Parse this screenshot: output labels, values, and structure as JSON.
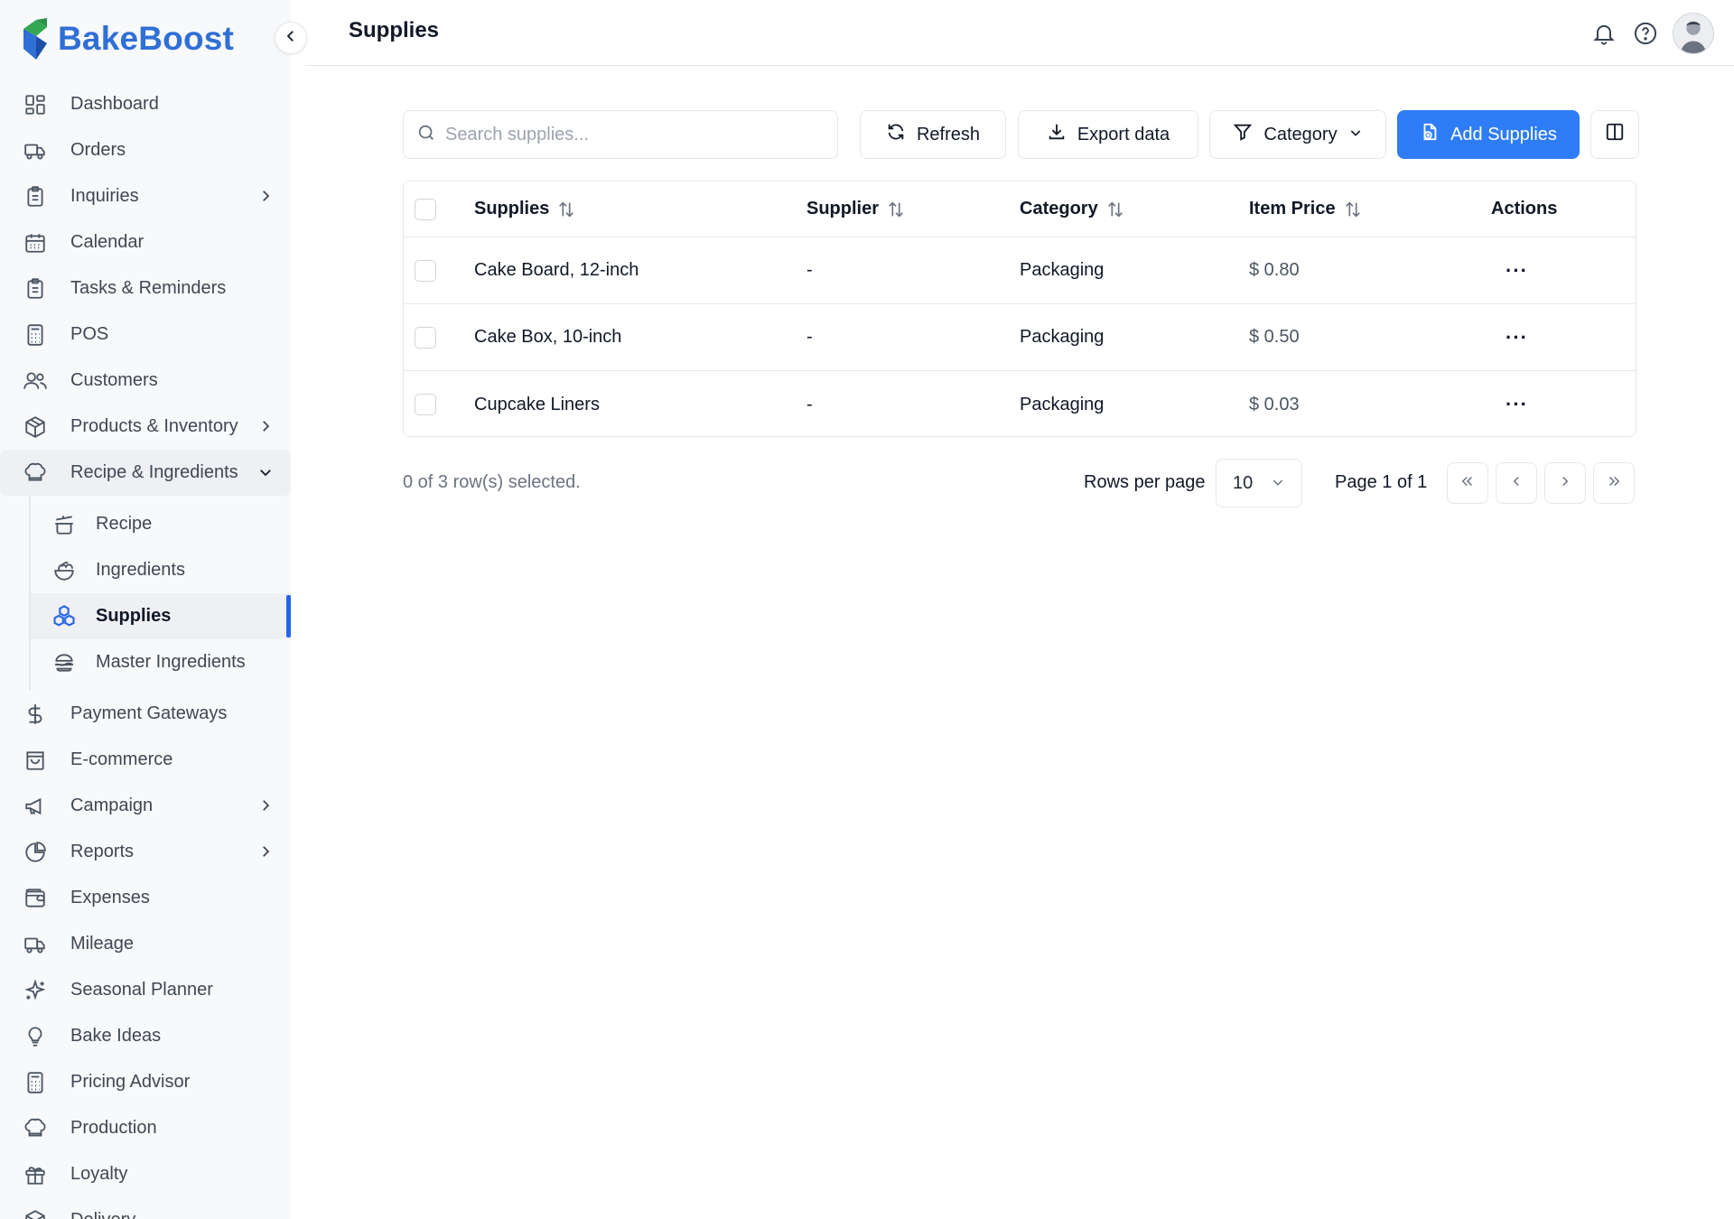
{
  "brand": {
    "name": "BakeBoost"
  },
  "colors": {
    "accent": "#2f7df6",
    "active_indicator": "#2563eb",
    "brand_text": "#2f6fd6"
  },
  "sidebar": {
    "items": [
      {
        "label": "Dashboard",
        "icon": "grid-icon"
      },
      {
        "label": "Orders",
        "icon": "truck-icon"
      },
      {
        "label": "Inquiries",
        "icon": "clipboard-icon",
        "has_submenu": true
      },
      {
        "label": "Calendar",
        "icon": "calendar-icon"
      },
      {
        "label": "Tasks & Reminders",
        "icon": "clipboard-list-icon"
      },
      {
        "label": "POS",
        "icon": "calculator-icon"
      },
      {
        "label": "Customers",
        "icon": "users-icon"
      },
      {
        "label": "Products & Inventory",
        "icon": "package-icon",
        "has_submenu": true
      },
      {
        "label": "Recipe & Ingredients",
        "icon": "chef-hat-icon",
        "expanded": true
      }
    ],
    "subitems": [
      {
        "label": "Recipe",
        "icon": "cooking-pot-icon"
      },
      {
        "label": "Ingredients",
        "icon": "salad-icon"
      },
      {
        "label": "Supplies",
        "icon": "boxes-icon",
        "active": true
      },
      {
        "label": "Master Ingredients",
        "icon": "sandwich-icon"
      }
    ],
    "items_after": [
      {
        "label": "Payment Gateways",
        "icon": "dollar-icon"
      },
      {
        "label": "E-commerce",
        "icon": "shopping-bag-icon"
      },
      {
        "label": "Campaign",
        "icon": "megaphone-icon",
        "has_submenu": true
      },
      {
        "label": "Reports",
        "icon": "pie-chart-icon",
        "has_submenu": true
      },
      {
        "label": "Expenses",
        "icon": "wallet-icon"
      },
      {
        "label": "Mileage",
        "icon": "truck-icon"
      },
      {
        "label": "Seasonal Planner",
        "icon": "sparkles-icon"
      },
      {
        "label": "Bake Ideas",
        "icon": "lightbulb-icon"
      },
      {
        "label": "Pricing Advisor",
        "icon": "calculator-icon"
      },
      {
        "label": "Production",
        "icon": "chef-hat-icon"
      },
      {
        "label": "Loyalty",
        "icon": "gift-icon"
      },
      {
        "label": "Delivery",
        "icon": "package-icon"
      }
    ]
  },
  "header": {
    "title": "Supplies"
  },
  "toolbar": {
    "search_placeholder": "Search supplies...",
    "refresh_label": "Refresh",
    "export_label": "Export data",
    "category_label": "Category",
    "add_label": "Add Supplies"
  },
  "table": {
    "columns": [
      "Supplies",
      "Supplier",
      "Category",
      "Item Price",
      "Actions"
    ],
    "rows": [
      {
        "name": "Cake Board, 12-inch",
        "supplier": "-",
        "category": "Packaging",
        "price": "$ 0.80"
      },
      {
        "name": "Cake Box, 10-inch",
        "supplier": "-",
        "category": "Packaging",
        "price": "$ 0.50"
      },
      {
        "name": "Cupcake Liners",
        "supplier": "-",
        "category": "Packaging",
        "price": "$ 0.03"
      }
    ],
    "actions_glyph": "···"
  },
  "footer": {
    "selection_text": "0 of 3 row(s) selected.",
    "rows_per_page_label": "Rows per page",
    "rows_per_page_value": "10",
    "page_info": "Page 1 of 1"
  }
}
